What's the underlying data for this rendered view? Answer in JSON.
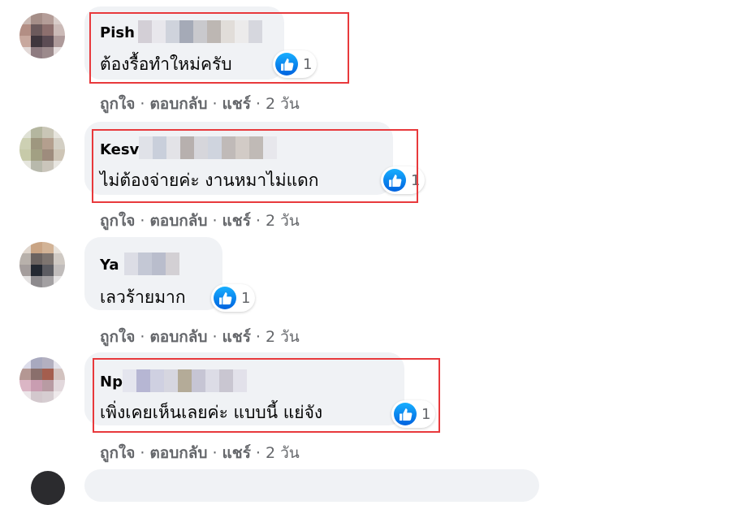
{
  "comments": [
    {
      "author": "Pish",
      "text": "ต้องรื้อทำใหม่ครับ",
      "reaction_count": "1",
      "actions": {
        "like": "ถูกใจ",
        "reply": "ตอบกลับ",
        "share": "แชร์",
        "time": "2 วัน"
      }
    },
    {
      "author": "Kesv",
      "text": "ไม่ต้องจ่ายค่ะ งานหมาไม่แดก",
      "reaction_count": "1",
      "actions": {
        "like": "ถูกใจ",
        "reply": "ตอบกลับ",
        "share": "แชร์",
        "time": "2 วัน"
      }
    },
    {
      "author": "Ya",
      "text": "เลวร้ายมาก",
      "reaction_count": "1",
      "actions": {
        "like": "ถูกใจ",
        "reply": "ตอบกลับ",
        "share": "แชร์",
        "time": "2 วัน"
      }
    },
    {
      "author": "Np",
      "text": "เพิ่งเคยเห็นเลยค่ะ แบบนี้ แย่จัง",
      "reaction_count": "1",
      "actions": {
        "like": "ถูกใจ",
        "reply": "ตอบกลับ",
        "share": "แชร์",
        "time": "2 วัน"
      }
    }
  ],
  "icons": {
    "reaction": "thumbs-up-icon"
  },
  "colors": {
    "highlight": "#e8393c",
    "bubble": "#f0f2f5",
    "like_blue": "#1877f2",
    "secondary_text": "#65676b"
  }
}
